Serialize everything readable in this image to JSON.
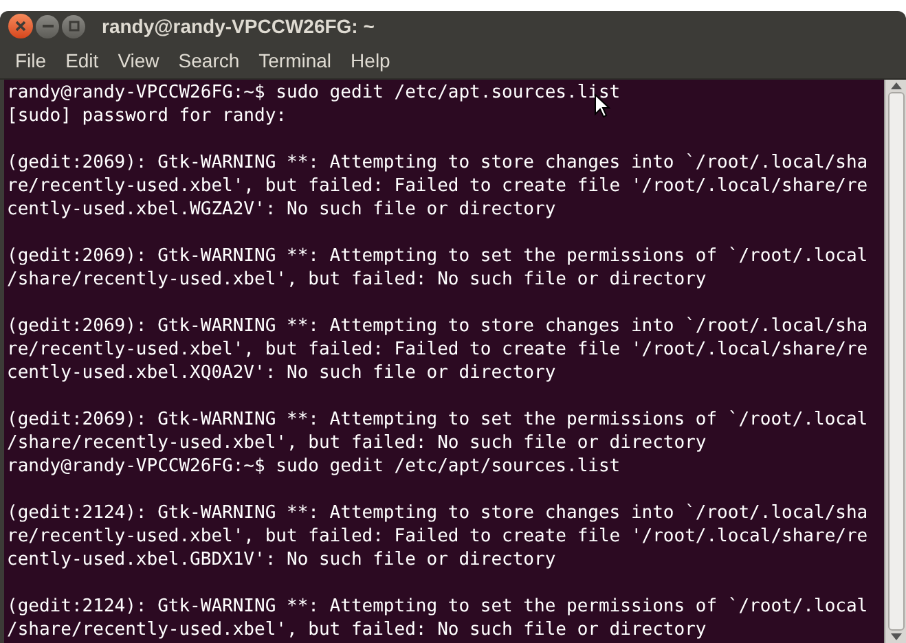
{
  "window": {
    "title": "randy@randy-VPCCW26FG: ~"
  },
  "menu": [
    "File",
    "Edit",
    "View",
    "Search",
    "Terminal",
    "Help"
  ],
  "terminal": {
    "lines": [
      {
        "kind": "text",
        "text": "randy@randy-VPCCW26FG:~$ sudo gedit /etc/apt.sources.list"
      },
      {
        "kind": "text",
        "text": "[sudo] password for randy:"
      },
      {
        "kind": "blank"
      },
      {
        "kind": "text",
        "text": "(gedit:2069): Gtk-WARNING **: Attempting to store changes into `/root/.local/sha"
      },
      {
        "kind": "text",
        "text": "re/recently-used.xbel', but failed: Failed to create file '/root/.local/share/re"
      },
      {
        "kind": "text",
        "text": "cently-used.xbel.WGZA2V': No such file or directory"
      },
      {
        "kind": "blank"
      },
      {
        "kind": "text",
        "text": "(gedit:2069): Gtk-WARNING **: Attempting to set the permissions of `/root/.local"
      },
      {
        "kind": "text",
        "text": "/share/recently-used.xbel', but failed: No such file or directory"
      },
      {
        "kind": "blank"
      },
      {
        "kind": "text",
        "text": "(gedit:2069): Gtk-WARNING **: Attempting to store changes into `/root/.local/sha"
      },
      {
        "kind": "text",
        "text": "re/recently-used.xbel', but failed: Failed to create file '/root/.local/share/re"
      },
      {
        "kind": "text",
        "text": "cently-used.xbel.XQ0A2V': No such file or directory"
      },
      {
        "kind": "blank"
      },
      {
        "kind": "text",
        "text": "(gedit:2069): Gtk-WARNING **: Attempting to set the permissions of `/root/.local"
      },
      {
        "kind": "text",
        "text": "/share/recently-used.xbel', but failed: No such file or directory"
      },
      {
        "kind": "text",
        "text": "randy@randy-VPCCW26FG:~$ sudo gedit /etc/apt/sources.list"
      },
      {
        "kind": "blank"
      },
      {
        "kind": "text",
        "text": "(gedit:2124): Gtk-WARNING **: Attempting to store changes into `/root/.local/sha"
      },
      {
        "kind": "text",
        "text": "re/recently-used.xbel', but failed: Failed to create file '/root/.local/share/re"
      },
      {
        "kind": "text",
        "text": "cently-used.xbel.GBDX1V': No such file or directory"
      },
      {
        "kind": "blank"
      },
      {
        "kind": "text",
        "text": "(gedit:2124): Gtk-WARNING **: Attempting to set the permissions of `/root/.local"
      },
      {
        "kind": "text",
        "text": "/share/recently-used.xbel', but failed: No such file or directory"
      }
    ]
  }
}
